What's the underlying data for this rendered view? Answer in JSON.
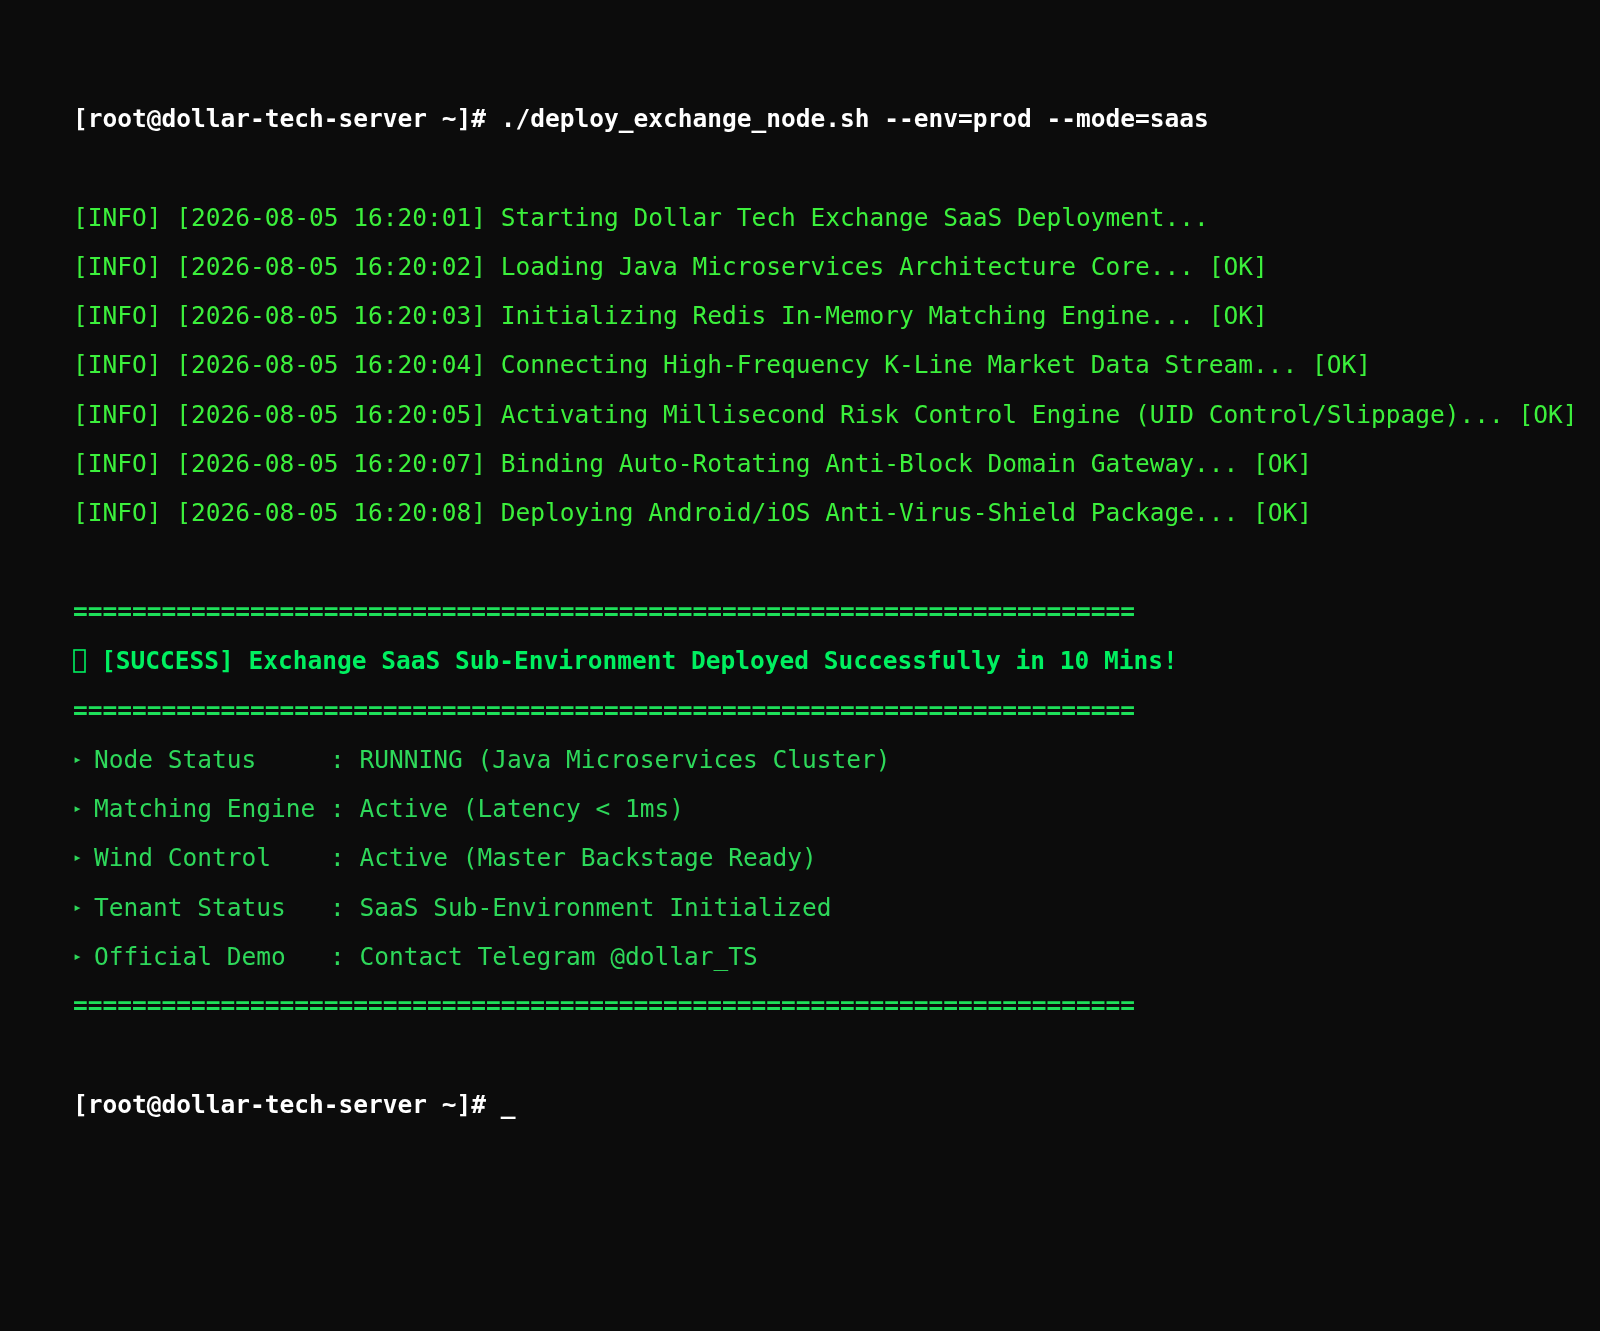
{
  "command": "[root@dollar-tech-server ~]# ./deploy_exchange_node.sh --env=prod --mode=saas",
  "log": [
    {
      "text": "[INFO] [2026-08-05 16:20:01] Starting Dollar Tech Exchange SaaS Deployment..."
    },
    {
      "text": "[INFO] [2026-08-05 16:20:02] Loading Java Microservices Architecture Core... [OK]"
    },
    {
      "text": "[INFO] [2026-08-05 16:20:03] Initializing Redis In-Memory Matching Engine... [OK]"
    },
    {
      "text": "[INFO] [2026-08-05 16:20:04] Connecting High-Frequency K-Line Market Data Stream... [OK]"
    },
    {
      "text": "[INFO] [2026-08-05 16:20:05] Activating Millisecond Risk Control Engine (UID Control/Slippage)... [OK]"
    },
    {
      "text": "[INFO] [2026-08-05 16:20:07] Binding Auto-Rotating Anti-Block Domain Gateway... [OK]"
    },
    {
      "text": "[INFO] [2026-08-05 16:20:08] Deploying Android/iOS Anti-Virus-Shield Package... [OK]"
    }
  ],
  "summary": [
    {
      "kind": "rule",
      "text": "========================================================================"
    },
    {
      "kind": "success",
      "text": "[SUCCESS] Exchange SaaS Sub-Environment Deployed Successfully in 10 Mins!"
    },
    {
      "kind": "rule",
      "text": "========================================================================"
    },
    {
      "kind": "status",
      "marker": "▸",
      "text": "Node Status     : RUNNING (Java Microservices Cluster)"
    },
    {
      "kind": "status",
      "marker": "▸",
      "text": "Matching Engine : Active (Latency < 1ms)"
    },
    {
      "kind": "status",
      "marker": "▸",
      "text": "Wind Control    : Active (Master Backstage Ready)"
    },
    {
      "kind": "status",
      "marker": "▸",
      "text": "Tenant Status   : SaaS Sub-Environment Initialized"
    },
    {
      "kind": "status",
      "marker": "▸",
      "text": "Official Demo   : Contact Telegram @dollar_TS"
    },
    {
      "kind": "rule",
      "text": "========================================================================"
    }
  ],
  "prompt": "[root@dollar-tech-server ~]# _"
}
